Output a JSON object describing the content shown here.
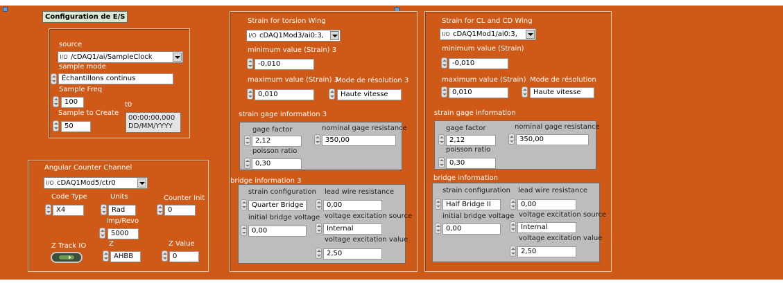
{
  "config": {
    "title": "Configuration de E/S"
  },
  "source": {
    "label": "source",
    "value": "/cDAQ1/ai/SampleClock"
  },
  "sample_mode": {
    "label": "sample mode",
    "value": "Échantillons continus"
  },
  "sample_freq": {
    "label": "Sample Freq",
    "value": "100"
  },
  "sample_to_create": {
    "label": "Sample to Create",
    "value": "50"
  },
  "t0": {
    "label": "t0",
    "line1": "00:00:00,000",
    "line2": "DD/MM/YYYY"
  },
  "angular": {
    "title": "Angular Counter Channel",
    "channel": "cDAQ1Mod5/ctr0",
    "code_type_label": "Code Type",
    "code_type": "X4",
    "units_label": "Units",
    "units": "Rad",
    "counter_init_label": "Counter Init",
    "counter_init": "0",
    "imp_revo_label": "Imp/Revo",
    "imp_revo": "5000",
    "z_track_label": "Z Track IO",
    "z_label": "Z",
    "z": "AHBB",
    "z_value_label": "Z Value",
    "z_value": "0"
  },
  "torsion": {
    "title": "Strain for torsion Wing",
    "channel": "cDAQ1Mod3/ai0:3,",
    "min_label": "minimum value (Strain) 3",
    "min": "-0,010",
    "max_label": "maximum value (Strain) 3",
    "max": "0,010",
    "mode_label": "Mode de résolution 3",
    "mode": "Haute vitesse",
    "gage_title": "strain gage information 3",
    "gage_factor_label": "gage factor",
    "gage_factor": "2,12",
    "nominal_label": "nominal gage resistance",
    "nominal": "350,00",
    "poisson_label": "poisson ratio",
    "poisson": "0,30",
    "bridge_title": "bridge information 3",
    "strain_config_label": "strain configuration",
    "strain_config": "Quarter Bridge I",
    "lead_label": "lead wire resistance",
    "lead": "0,00",
    "init_label": "initial bridge voltage",
    "init": "0,00",
    "vsource_label": "voltage excitation source",
    "vsource": "Internal",
    "vvalue_label": "voltage excitation value",
    "vvalue": "2,50"
  },
  "clcd": {
    "title": "Strain for CL and CD Wing",
    "channel": "cDAQ1Mod1/ai0:3,",
    "min_label": "minimum value (Strain)",
    "min": "-0,010",
    "max_label": "maximum value (Strain)",
    "max": "0,010",
    "mode_label": "Mode de résolution",
    "mode": "Haute vitesse",
    "gage_title": "strain gage information",
    "gage_factor_label": "gage factor",
    "gage_factor": "2,12",
    "nominal_label": "nominal gage resistance",
    "nominal": "350,00",
    "poisson_label": "poisson ratio",
    "poisson": "0,30",
    "bridge_title": "bridge information",
    "strain_config_label": "strain configuration",
    "strain_config": "Half Bridge II",
    "lead_label": "lead wire resistance",
    "lead": "0,00",
    "init_label": "initial bridge voltage",
    "init": "0,00",
    "vsource_label": "voltage excitation source",
    "vsource": "Internal",
    "vvalue_label": "voltage excitation value",
    "vvalue": "2,50"
  },
  "colors": {
    "background": "#cf5a17",
    "panel_gray": "#bdbdbd"
  },
  "icons": {
    "io": "io-name-icon",
    "spin": "increment-decrement-icon",
    "dropdown": "dropdown-arrow-icon"
  }
}
